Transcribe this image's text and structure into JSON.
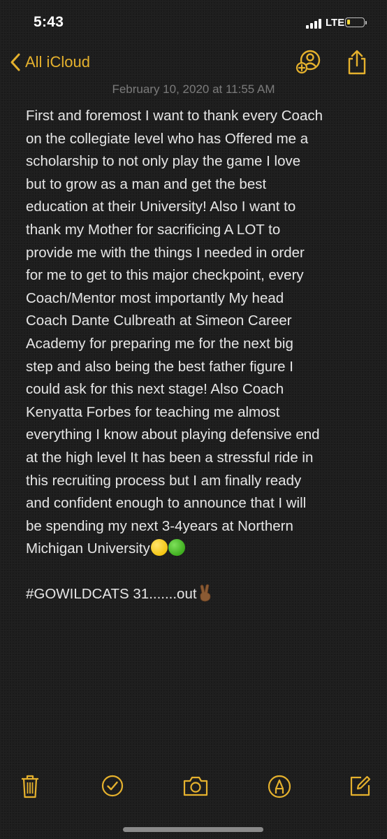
{
  "status_bar": {
    "time": "5:43",
    "network": "LTE",
    "battery_level": 0.2
  },
  "nav": {
    "back_label": "All iCloud",
    "icons": [
      "chevron-left-icon",
      "add-person-icon",
      "share-icon"
    ]
  },
  "note": {
    "timestamp": "February 10, 2020 at 11:55 AM",
    "lines": [
      "First and foremost I want to thank every Coach",
      "on the collegiate level who has Offered me a",
      "scholarship to not only play the game I love",
      "but to grow as a man and get the best",
      "education at their University! Also I want to",
      "thank my Mother for sacrificing A LOT to",
      "provide me with the things I needed in order",
      "for me to get to this major checkpoint, every",
      "Coach/Mentor most importantly My head",
      "Coach Dante Culbreath at Simeon Career",
      "Academy for preparing me for the next big",
      "step and also being the best father figure I",
      "could ask for this next stage! Also Coach",
      "Kenyatta Forbes for teaching me almost",
      "everything I know about playing defensive end",
      "at the high level It has been a stressful ride in",
      "this recruiting process but I am finally ready",
      "and confident enough to announce that I will",
      "be spending my next 3-4years at Northern",
      "Michigan University"
    ],
    "closing": "#GOWILDCATS 31.......out"
  },
  "toolbar": {
    "icons": [
      "trash-icon",
      "checklist-icon",
      "camera-icon",
      "markup-icon",
      "compose-icon"
    ]
  },
  "colors": {
    "accent": "#e5b12d",
    "background": "#1e1e1e",
    "text": "#e6e6e6",
    "timestamp": "#7b7b7b"
  }
}
